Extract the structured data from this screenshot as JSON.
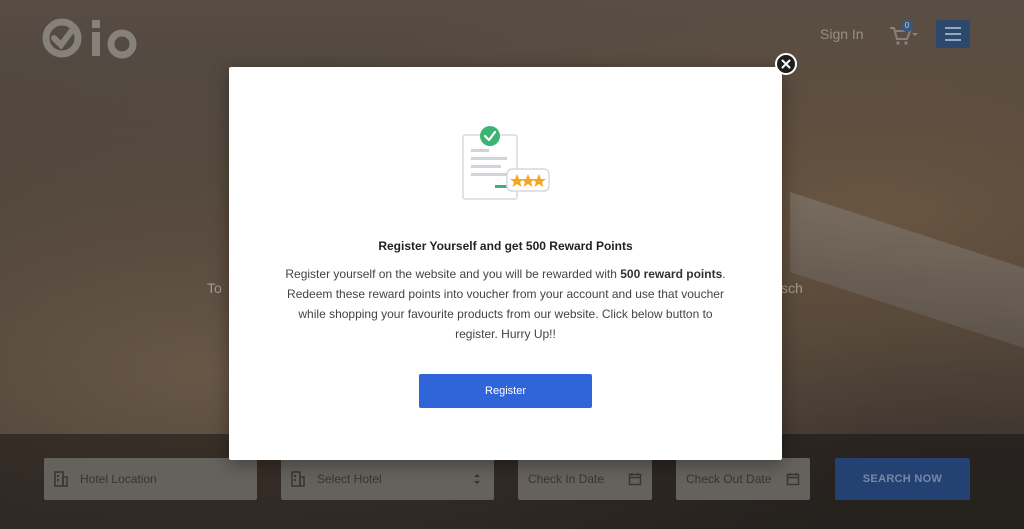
{
  "header": {
    "logo_text": "Qlo",
    "signin_label": "Sign In",
    "cart_count": "0"
  },
  "hero": {
    "text_left": "To",
    "text_right": "sch"
  },
  "search": {
    "location_placeholder": "Hotel Location",
    "hotel_select": "Select Hotel",
    "checkin_placeholder": "Check In Date",
    "checkout_placeholder": "Check Out Date",
    "button_label": "SEARCH NOW"
  },
  "modal": {
    "title": "Register Yourself and get 500 Reward Points",
    "body_part1": "Register yourself on the website and you will be rewarded with ",
    "body_bold": "500 reward points",
    "body_part2": ". Redeem these reward points into voucher from your account and use that voucher while shopping your favourite products from our website. Click below button to register. Hurry Up!!",
    "register_label": "Register"
  },
  "colors": {
    "accent": "#3065d9",
    "check_green": "#3cb371",
    "star_orange": "#f5a623"
  },
  "icons": [
    "close-icon",
    "reward-document-icon",
    "cart-icon",
    "hamburger-icon",
    "building-icon",
    "calendar-icon",
    "caret-updown-icon"
  ]
}
